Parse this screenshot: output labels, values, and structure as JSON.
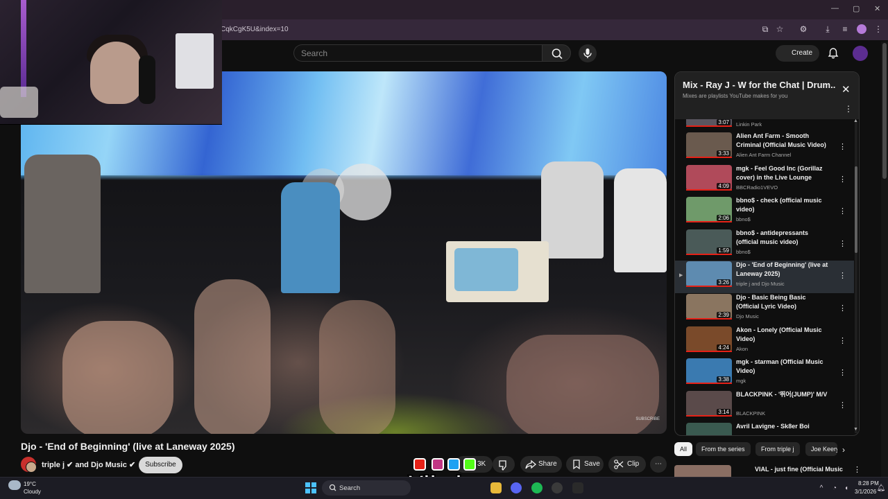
{
  "browser": {
    "url": "CqkCgK5U&index=10"
  },
  "header": {
    "search_placeholder": "Search",
    "create_label": "Create"
  },
  "video": {
    "title": "Djo - 'End of Beginning' (live at Laneway 2025)",
    "channels": "triple j ✔ and Djo Music ✔",
    "subscribe_label": "Subscribe",
    "watermark": "SUBSCRIBE",
    "actions": {
      "like_count": "3K",
      "share": "Share",
      "save": "Save",
      "clip": "Clip"
    }
  },
  "playlist": {
    "title": "Mix - Ray J - W for the Chat | Drum...",
    "subtitle": "Mixes are playlists YouTube makes for you",
    "partial_top": {
      "duration": "3:07",
      "channel": "Linkin Park"
    },
    "items": [
      {
        "title": "Alien Ant Farm - Smooth Criminal (Official Music Video)",
        "channel": "Alien Ant Farm Channel",
        "duration": "3:33",
        "color": "#6a5a4e",
        "active": false
      },
      {
        "title": "mgk - Feel Good Inc (Gorillaz cover) in the Live Lounge",
        "channel": "BBCRadio1VEVO",
        "duration": "4:09",
        "color": "#b04a5a",
        "active": false
      },
      {
        "title": "bbno$ - check (official music video)",
        "channel": "bbno$",
        "duration": "2:06",
        "color": "#6f9a6a",
        "active": false
      },
      {
        "title": "bbno$ - antidepressants (official music video)",
        "channel": "bbno$",
        "duration": "1:59",
        "color": "#4a5a58",
        "active": false
      },
      {
        "title": "Djo - 'End of Beginning' (live at Laneway 2025)",
        "channel": "triple j and Djo Music",
        "duration": "3:26",
        "color": "#5e8bb0",
        "active": true
      },
      {
        "title": "Djo - Basic Being Basic (Official Lyric Video)",
        "channel": "Djo Music",
        "duration": "2:39",
        "color": "#8a7560",
        "active": false
      },
      {
        "title": "Akon - Lonely (Official Music Video)",
        "channel": "Akon",
        "duration": "4:24",
        "color": "#7a4a2a",
        "active": false
      },
      {
        "title": "mgk - starman (Official Music Video)",
        "channel": "mgk",
        "duration": "3:38",
        "color": "#3a7ab0",
        "active": false
      },
      {
        "title": "BLACKPINK - '뛰어(JUMP)' M/V",
        "channel": "BLACKPINK",
        "duration": "3:14",
        "color": "#5a4a4a",
        "active": false
      },
      {
        "title": "Avril Lavigne - Sk8er Boi",
        "channel": "",
        "duration": "",
        "color": "#3a5a50",
        "active": false
      }
    ]
  },
  "chips": [
    "All",
    "From the series",
    "From triple j",
    "Joe Keery"
  ],
  "next_video": {
    "title": "VIAL - just fine (Official Music"
  },
  "overlay": {
    "brand": "Vibzlo"
  },
  "taskbar": {
    "temp": "19°C",
    "condition": "Cloudy",
    "search_label": "Search",
    "time": "8:28 PM",
    "date": "3/1/2026"
  }
}
